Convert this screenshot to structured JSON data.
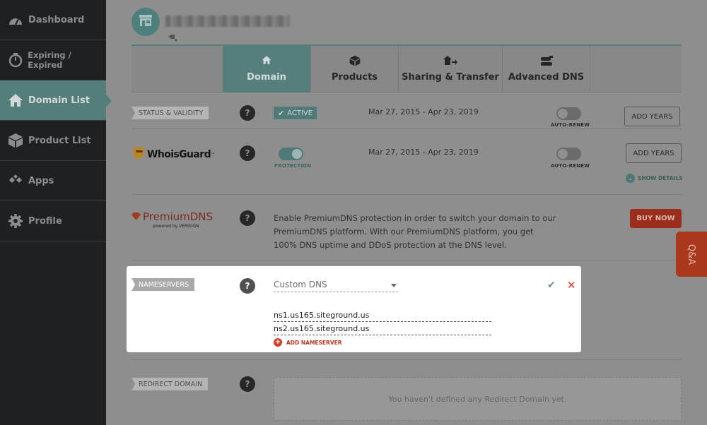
{
  "sidebar": {
    "items": [
      {
        "label": "Dashboard",
        "icon": "gauge-icon"
      },
      {
        "label": "Expiring / Expired",
        "icon": "timer-icon"
      },
      {
        "label": "Domain List",
        "icon": "home-icon"
      },
      {
        "label": "Product List",
        "icon": "box-icon"
      },
      {
        "label": "Apps",
        "icon": "diamonds-icon"
      },
      {
        "label": "Profile",
        "icon": "gear-icon"
      }
    ],
    "active": "Domain List"
  },
  "tabs": [
    {
      "label": "Domain",
      "icon": "home-icon"
    },
    {
      "label": "Products",
      "icon": "box-icon"
    },
    {
      "label": "Sharing & Transfer",
      "icon": "transfer-icon"
    },
    {
      "label": "Advanced DNS",
      "icon": "dns-icon"
    }
  ],
  "status": {
    "label": "STATUS & VALIDITY",
    "help": "?",
    "badge": "ACTIVE",
    "dates": "Mar 27, 2015 - Apr 23, 2019",
    "auto_renew": "AUTO-RENEW",
    "button": "ADD YEARS"
  },
  "whoisguard": {
    "logo": "WhoisGuard",
    "tm": "™",
    "help": "?",
    "protection": "PROTECTION",
    "dates": "Mar 27, 2015 - Apr 23, 2019",
    "auto_renew": "AUTO-RENEW",
    "button": "ADD YEARS",
    "show_details": "SHOW DETAILS"
  },
  "premiumdns": {
    "logo": "PremiumDNS",
    "powered_by": "powered by VERISIGN",
    "help": "?",
    "description": "Enable PremiumDNS protection in order to switch your domain to our PremiumDNS platform. With our PremiumDNS platform, you get 100% DNS uptime and DDoS protection at the DNS level.",
    "button": "BUY NOW"
  },
  "nameservers": {
    "label": "NAMESERVERS",
    "help": "?",
    "selected": "Custom DNS",
    "entries": [
      "ns1.us165.siteground.us",
      "ns2.us165.siteground.us"
    ],
    "add_label": "ADD NAMESERVER"
  },
  "redirect": {
    "label": "REDIRECT DOMAIN",
    "help": "?",
    "empty_text": "You haven't defined any Redirect Domain yet."
  },
  "qa_label": "Q&A",
  "colors": {
    "accent": "#567f7c",
    "danger": "#d9391d",
    "sidebar": "#1f2022"
  }
}
